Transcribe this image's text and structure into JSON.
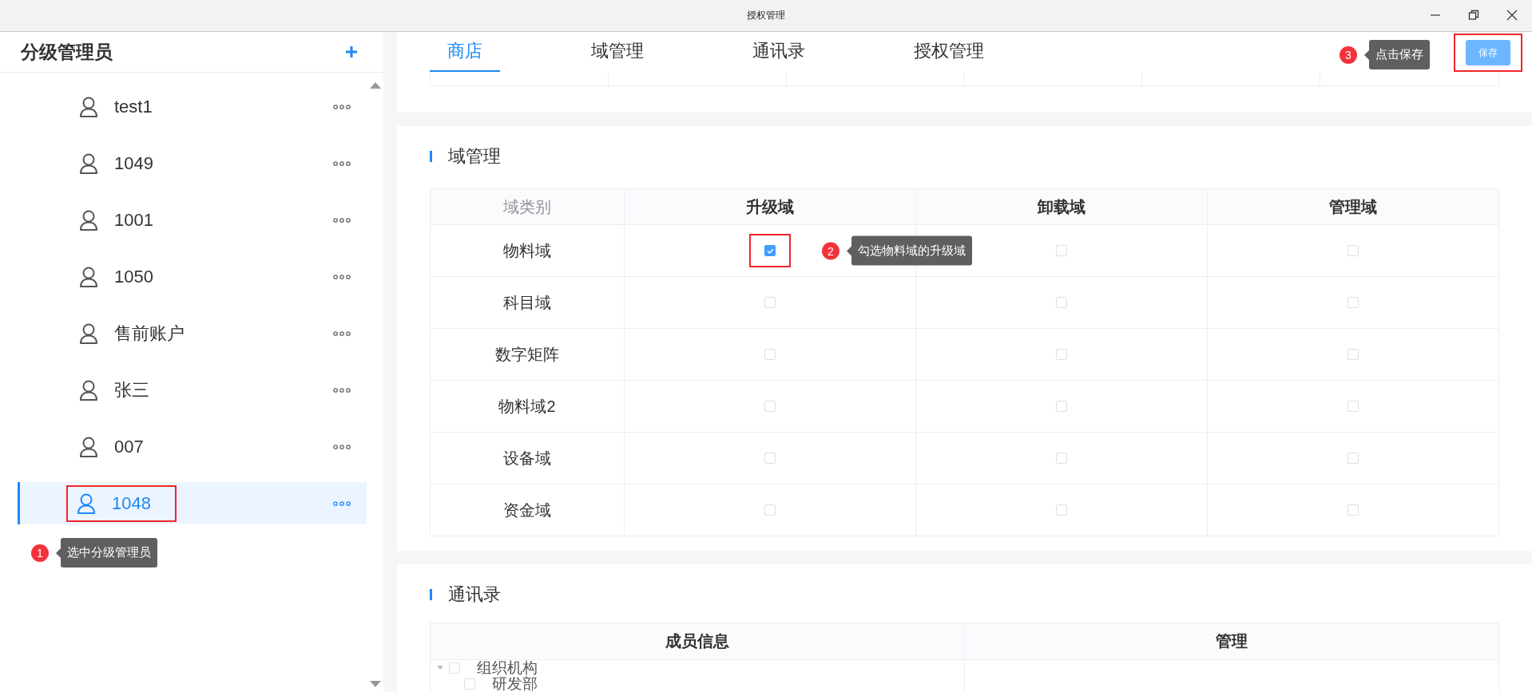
{
  "window": {
    "title": "授权管理"
  },
  "sidebar": {
    "title": "分级管理员",
    "items": [
      {
        "name": "test1",
        "selected": false
      },
      {
        "name": "1049",
        "selected": false
      },
      {
        "name": "1001",
        "selected": false
      },
      {
        "name": "1050",
        "selected": false
      },
      {
        "name": "售前账户",
        "selected": false
      },
      {
        "name": "张三",
        "selected": false
      },
      {
        "name": "007",
        "selected": false
      },
      {
        "name": "1048",
        "selected": true,
        "callout": {
          "number": "1",
          "text": "选中分级管理员"
        }
      }
    ]
  },
  "tabs": [
    {
      "label": "商店",
      "selected": true
    },
    {
      "label": "域管理",
      "selected": false
    },
    {
      "label": "通讯录",
      "selected": false
    },
    {
      "label": "授权管理",
      "selected": false
    }
  ],
  "save_button": {
    "label": "保存",
    "callout": {
      "number": "3",
      "text": "点击保存"
    }
  },
  "domain_section": {
    "title": "域管理",
    "columns": [
      "域类别",
      "升级域",
      "卸载域",
      "管理域"
    ],
    "rows": [
      {
        "cells": [
          {
            "kind": "label",
            "text": "物料域"
          },
          {
            "kind": "checkbox",
            "checked": true,
            "callout": {
              "number": "2",
              "text": "勾选物料域的升级域"
            }
          },
          {
            "kind": "checkbox",
            "checked": false
          },
          {
            "kind": "checkbox",
            "checked": false
          }
        ]
      },
      {
        "cells": [
          {
            "kind": "label",
            "text": "科目域"
          },
          {
            "kind": "checkbox",
            "checked": false
          },
          {
            "kind": "checkbox",
            "checked": false
          },
          {
            "kind": "checkbox",
            "checked": false
          }
        ]
      },
      {
        "cells": [
          {
            "kind": "label",
            "text": "数字矩阵"
          },
          {
            "kind": "checkbox",
            "checked": false
          },
          {
            "kind": "checkbox",
            "checked": false
          },
          {
            "kind": "checkbox",
            "checked": false
          }
        ]
      },
      {
        "cells": [
          {
            "kind": "label",
            "text": "物料域2"
          },
          {
            "kind": "checkbox",
            "checked": false
          },
          {
            "kind": "checkbox",
            "checked": false
          },
          {
            "kind": "checkbox",
            "checked": false
          }
        ]
      },
      {
        "cells": [
          {
            "kind": "label",
            "text": "设备域"
          },
          {
            "kind": "checkbox",
            "checked": false
          },
          {
            "kind": "checkbox",
            "checked": false
          },
          {
            "kind": "checkbox",
            "checked": false
          }
        ]
      },
      {
        "cells": [
          {
            "kind": "label",
            "text": "资金域"
          },
          {
            "kind": "checkbox",
            "checked": false
          },
          {
            "kind": "checkbox",
            "checked": false
          },
          {
            "kind": "checkbox",
            "checked": false
          }
        ]
      }
    ]
  },
  "contacts_section": {
    "title": "通讯录",
    "columns": [
      "成员信息",
      "管理"
    ],
    "tree": [
      {
        "label": "组织机构",
        "expanded": true,
        "checked": false,
        "children": [
          {
            "label": "研发部",
            "checked": false
          }
        ]
      }
    ]
  }
}
